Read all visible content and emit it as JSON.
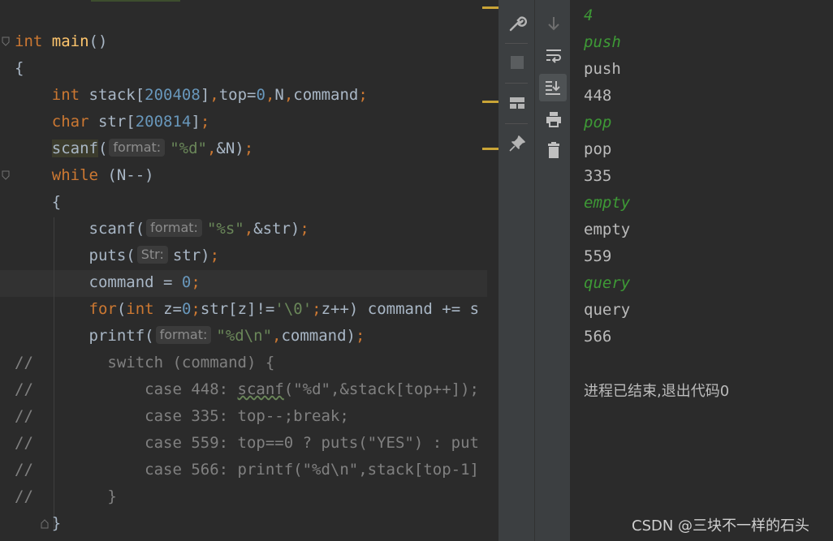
{
  "editor": {
    "lines": [
      {
        "id": "l_main",
        "tokens": [
          {
            "c": "kw",
            "t": "int"
          },
          {
            "c": "",
            "t": " "
          },
          {
            "c": "fn",
            "t": "main"
          },
          {
            "c": "",
            "t": "()"
          }
        ]
      },
      {
        "id": "l_brace1",
        "tokens": [
          {
            "c": "",
            "t": "{"
          }
        ]
      },
      {
        "id": "l_decl1",
        "tokens": [
          {
            "c": "",
            "t": "    "
          },
          {
            "c": "kw",
            "t": "int"
          },
          {
            "c": "",
            "t": " stack["
          },
          {
            "c": "num",
            "t": "200408"
          },
          {
            "c": "",
            "t": "]"
          },
          {
            "c": "kw",
            "t": ","
          },
          {
            "c": "",
            "t": "top="
          },
          {
            "c": "num",
            "t": "0"
          },
          {
            "c": "kw",
            "t": ","
          },
          {
            "c": "",
            "t": "N"
          },
          {
            "c": "kw",
            "t": ","
          },
          {
            "c": "",
            "t": "command"
          },
          {
            "c": "kw",
            "t": ";"
          }
        ]
      },
      {
        "id": "l_decl2",
        "tokens": [
          {
            "c": "",
            "t": "    "
          },
          {
            "c": "kw",
            "t": "char"
          },
          {
            "c": "",
            "t": " str["
          },
          {
            "c": "num",
            "t": "200814"
          },
          {
            "c": "",
            "t": "]"
          },
          {
            "c": "kw",
            "t": ";"
          }
        ]
      },
      {
        "id": "l_scanfN",
        "tokens": [
          {
            "c": "",
            "t": "    "
          },
          {
            "c": "hl",
            "t": "scanf"
          },
          {
            "c": "",
            "t": "("
          },
          {
            "c": "hint",
            "t": "format:"
          },
          {
            "c": "str",
            "t": "\"%d\""
          },
          {
            "c": "kw",
            "t": ","
          },
          {
            "c": "",
            "t": "&N)"
          },
          {
            "c": "kw",
            "t": ";"
          }
        ]
      },
      {
        "id": "l_while",
        "tokens": [
          {
            "c": "",
            "t": "    "
          },
          {
            "c": "kw",
            "t": "while"
          },
          {
            "c": "",
            "t": " (N--)"
          }
        ]
      },
      {
        "id": "l_brace2",
        "tokens": [
          {
            "c": "",
            "t": "    {"
          }
        ]
      },
      {
        "id": "l_scanfs",
        "tokens": [
          {
            "c": "",
            "t": "        scanf("
          },
          {
            "c": "hint",
            "t": "format:"
          },
          {
            "c": "str",
            "t": "\"%s\""
          },
          {
            "c": "kw",
            "t": ","
          },
          {
            "c": "",
            "t": "&str)"
          },
          {
            "c": "kw",
            "t": ";"
          }
        ]
      },
      {
        "id": "l_puts",
        "tokens": [
          {
            "c": "",
            "t": "        puts("
          },
          {
            "c": "hint",
            "t": "Str:"
          },
          {
            "c": "",
            "t": "str)"
          },
          {
            "c": "kw",
            "t": ";"
          }
        ]
      },
      {
        "id": "l_cmd0",
        "tokens": [
          {
            "c": "",
            "t": "        command = "
          },
          {
            "c": "num",
            "t": "0"
          },
          {
            "c": "kw",
            "t": ";"
          }
        ]
      },
      {
        "id": "l_for",
        "tokens": [
          {
            "c": "",
            "t": "        "
          },
          {
            "c": "kw",
            "t": "for"
          },
          {
            "c": "",
            "t": "("
          },
          {
            "c": "kw",
            "t": "int"
          },
          {
            "c": "",
            "t": " z="
          },
          {
            "c": "num",
            "t": "0"
          },
          {
            "c": "kw",
            "t": ";"
          },
          {
            "c": "",
            "t": "str[z]!="
          },
          {
            "c": "str",
            "t": "'\\0'"
          },
          {
            "c": "kw",
            "t": ";"
          },
          {
            "c": "",
            "t": "z++) command += s"
          }
        ]
      },
      {
        "id": "l_printf",
        "tokens": [
          {
            "c": "",
            "t": "        printf("
          },
          {
            "c": "hint",
            "t": "format:"
          },
          {
            "c": "str",
            "t": "\"%d\\n\""
          },
          {
            "c": "kw",
            "t": ","
          },
          {
            "c": "",
            "t": "command)"
          },
          {
            "c": "kw",
            "t": ";"
          }
        ]
      },
      {
        "id": "l_c1",
        "tokens": [
          {
            "c": "cmt",
            "t": "//        switch (command) {"
          }
        ]
      },
      {
        "id": "l_c2",
        "tokens": [
          {
            "c": "cmt",
            "t": "//            case 448: "
          },
          {
            "c": "cmt squiggle",
            "t": "scanf"
          },
          {
            "c": "cmt",
            "t": "(\"%d\",&stack[top++]);"
          }
        ]
      },
      {
        "id": "l_c3",
        "tokens": [
          {
            "c": "cmt",
            "t": "//            case 335: top--;break;"
          }
        ]
      },
      {
        "id": "l_c4",
        "tokens": [
          {
            "c": "cmt",
            "t": "//            case 559: top==0 ? puts(\"YES\") : put"
          }
        ]
      },
      {
        "id": "l_c5",
        "tokens": [
          {
            "c": "cmt",
            "t": "//            case 566: printf(\"%d\\n\",stack[top-1]"
          }
        ]
      },
      {
        "id": "l_c6",
        "tokens": [
          {
            "c": "cmt",
            "t": "//        }"
          }
        ]
      },
      {
        "id": "l_brace3",
        "tokens": [
          {
            "c": "",
            "t": "    }"
          }
        ]
      }
    ]
  },
  "toolbar_left": {
    "icons": [
      "wrench-icon",
      "stop-icon",
      "layout-icon",
      "pin-icon"
    ]
  },
  "toolbar_right": {
    "icons": [
      "arrow-down-icon",
      "soft-wrap-icon",
      "scroll-to-end-icon",
      "print-icon",
      "trash-icon"
    ]
  },
  "console": {
    "lines": [
      {
        "kind": "in",
        "text": "4"
      },
      {
        "kind": "in",
        "text": "push"
      },
      {
        "kind": "std",
        "text": "push"
      },
      {
        "kind": "std",
        "text": "448"
      },
      {
        "kind": "in",
        "text": "pop"
      },
      {
        "kind": "std",
        "text": "pop"
      },
      {
        "kind": "std",
        "text": "335"
      },
      {
        "kind": "in",
        "text": "empty"
      },
      {
        "kind": "std",
        "text": "empty"
      },
      {
        "kind": "std",
        "text": "559"
      },
      {
        "kind": "in",
        "text": "query"
      },
      {
        "kind": "std",
        "text": "query"
      },
      {
        "kind": "std",
        "text": "566"
      }
    ],
    "exit_message": "进程已结束,退出代码0"
  },
  "watermark": "CSDN @三块不一样的石头",
  "colors": {
    "keyword": "#cc7832",
    "function": "#ffc66d",
    "number": "#6897bb",
    "string": "#6a8759",
    "comment": "#808080",
    "console_input": "#3e9a36",
    "background": "#2b2b2b"
  }
}
